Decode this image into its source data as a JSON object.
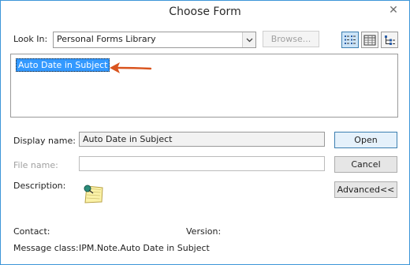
{
  "window": {
    "title": "Choose Form",
    "close_glyph": "✕"
  },
  "look_in": {
    "label": "Look In:",
    "selected": "Personal Forms Library",
    "dropdown_glyph": "⌄",
    "browse_label": "Browse..."
  },
  "view_buttons": [
    {
      "name": "list-view-icon",
      "active": true
    },
    {
      "name": "details-view-icon",
      "active": false
    },
    {
      "name": "hierarchy-view-icon",
      "active": false
    }
  ],
  "forms_list": {
    "items": [
      "Auto Date in Subject"
    ],
    "selected_index": 0,
    "annotation_arrow_color": "#d9541e"
  },
  "display_name": {
    "label": "Display name:",
    "value": "Auto Date in Subject"
  },
  "file_name": {
    "label": "File name:",
    "value": ""
  },
  "description": {
    "label": "Description:",
    "icon": "form-pushpin-icon"
  },
  "buttons": {
    "open": "Open",
    "cancel": "Cancel",
    "advanced": "Advanced<<"
  },
  "footer": {
    "contact_label": "Contact:",
    "version_label": "Version:",
    "message_class_label": "Message class:",
    "message_class_value": "IPM.Note.Auto Date in Subject"
  },
  "colors": {
    "selection": "#3399ff",
    "window_border": "#3d96d8",
    "default_button_border": "#3c7fb1"
  }
}
